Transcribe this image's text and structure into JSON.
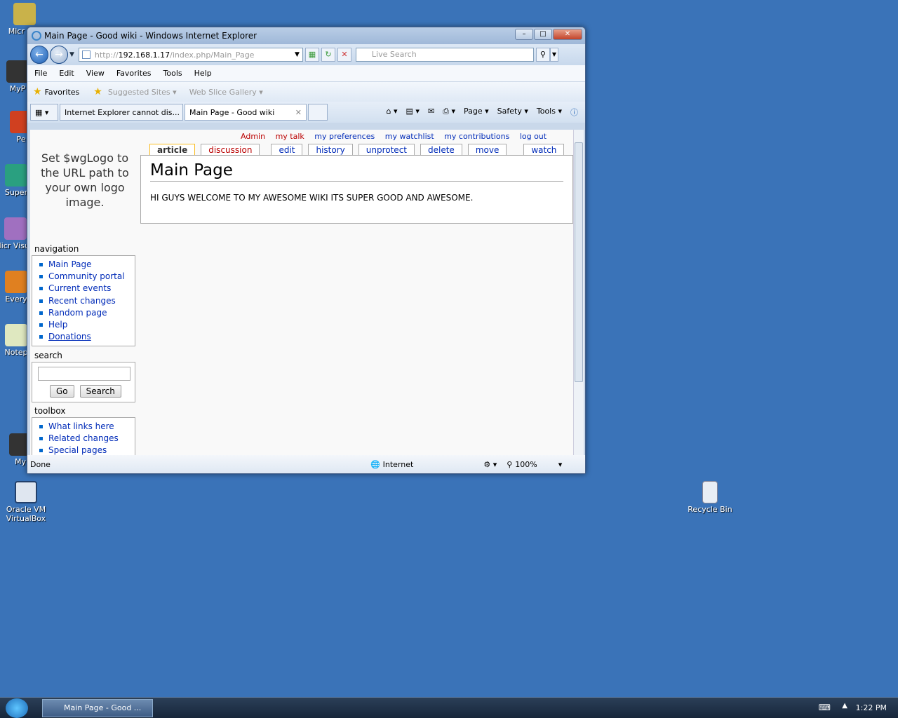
{
  "desktop": {
    "icons": [
      "Micr Out",
      "MyP",
      "Pe",
      "Super",
      "Micr Visual",
      "Every",
      "Notep",
      "My",
      "Oracle VM VirtualBox",
      "Recycle Bin"
    ]
  },
  "window": {
    "title": "Main Page - Good wiki - Windows Internet Explorer",
    "min_label": "–",
    "max_label": "□",
    "close_label": "✕"
  },
  "address": {
    "prefix": "http://",
    "host": "192.168.1.17",
    "path": "/index.php/Main_Page"
  },
  "search": {
    "placeholder": "Live Search"
  },
  "menu": [
    "File",
    "Edit",
    "View",
    "Favorites",
    "Tools",
    "Help"
  ],
  "favbar": {
    "favorites": "Favorites",
    "suggested": "Suggested Sites ▾",
    "slice": "Web Slice Gallery ▾"
  },
  "tabs": [
    {
      "label": "Internet Explorer cannot dis..."
    },
    {
      "label": "Main Page - Good wiki"
    }
  ],
  "toolbar": {
    "page": "Page ▾",
    "safety": "Safety ▾",
    "tools": "Tools ▾"
  },
  "wiki": {
    "personal": [
      "Admin",
      "my talk",
      "my preferences",
      "my watchlist",
      "my contributions",
      "log out"
    ],
    "tabs": [
      "article",
      "discussion",
      "edit",
      "history",
      "unprotect",
      "delete",
      "move",
      "watch"
    ],
    "title": "Main Page",
    "body": "HI GUYS WELCOME TO MY AWESOME WIKI ITS SUPER GOOD AND AWESOME.",
    "logo_text": "Set $wgLogo to the URL path to your own logo image.",
    "navigation_title": "navigation",
    "navigation": [
      "Main Page",
      "Community portal",
      "Current events",
      "Recent changes",
      "Random page",
      "Help",
      "Donations"
    ],
    "search_title": "search",
    "go_label": "Go",
    "search_label": "Search",
    "toolbox_title": "toolbox",
    "toolbox": [
      "What links here",
      "Related changes",
      "Special pages"
    ]
  },
  "statusbar": {
    "left": "Done",
    "zone": "Internet",
    "zoom": "100%"
  },
  "taskbar": {
    "button": "Main Page - Good ...",
    "clock": "1:22 PM"
  }
}
